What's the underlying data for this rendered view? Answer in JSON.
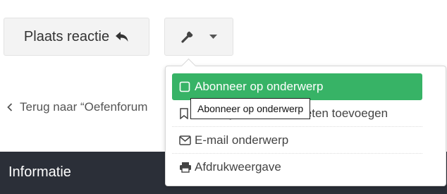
{
  "toolbar": {
    "reply_label": "Plaats reactie",
    "reply_icon": "reply-icon",
    "tools_icon": "wrench-icon",
    "tools_caret_icon": "caret-down-icon"
  },
  "back_link": {
    "label": "Terug naar “Oefenforum"
  },
  "footer": {
    "title": "Informatie"
  },
  "dropdown": {
    "items": [
      {
        "label": "Abonneer op onderwerp",
        "icon": "square-icon",
        "active": true
      },
      {
        "label": "Bladwijzer aan favorieten toevoegen",
        "icon": "bookmark-icon",
        "active": false
      },
      {
        "label": "E-mail onderwerp",
        "icon": "envelope-icon",
        "active": false
      },
      {
        "label": "Afdrukweergave",
        "icon": "print-icon",
        "active": false
      }
    ]
  },
  "tooltip": {
    "text": "Abonneer op onderwerp"
  },
  "colors": {
    "accent": "#37b366",
    "footer_bg": "#2b2f38",
    "button_bg": "#f3f3f3"
  }
}
